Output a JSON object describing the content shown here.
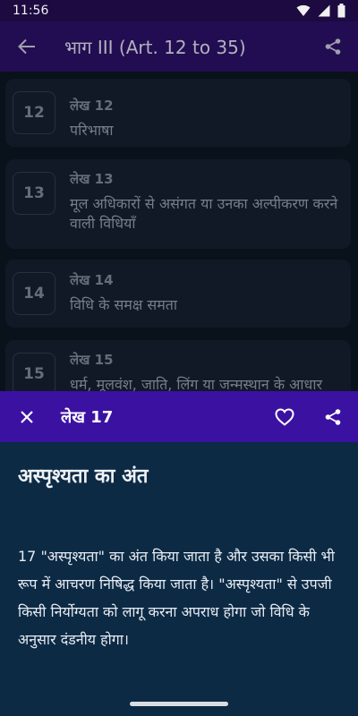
{
  "status": {
    "time": "11:56"
  },
  "app_bar": {
    "title": "भाग III (Art. 12 to 35)"
  },
  "articles": [
    {
      "number": "12",
      "label": "लेख 12",
      "desc": " परिभाषा"
    },
    {
      "number": "13",
      "label": "लेख 13",
      "desc": " मूल अधिकारों से असंगत या उनका अल्पीकरण करने वाली विधियाँ"
    },
    {
      "number": "14",
      "label": "लेख 14",
      "desc": " विधि के समक्ष समता"
    },
    {
      "number": "15",
      "label": "लेख 15",
      "desc": " धर्म, मूलवंश, जाति, लिंग या जन्मस्थान के आधार"
    }
  ],
  "sheet": {
    "title": "लेख 17",
    "heading": "अस्पृश्यता का अंत",
    "body_lines": [
      "17 \"अस्पृश्यता\" का अंत किया जाता है और उसका किसी भी",
      "रूप में आचरण निषिद्ध किया जाता है। \"अस्पृश्यता\" से उपजी",
      "किसी निर्योग्यता को लागू करना अपराध होगा जो विधि के",
      "अनुसार दंडनीय होगा।"
    ]
  },
  "icons": {
    "back": "arrow-left-icon",
    "share": "share-icon",
    "close": "close-icon",
    "favorite": "heart-icon",
    "wifi": "wifi-icon",
    "signal": "signal-icon",
    "battery": "battery-icon"
  },
  "colors": {
    "status_bar": "#1c0a40",
    "app_bar": "#2a1166",
    "sheet_header": "#3b11a2",
    "sheet_body": "#0d2a44",
    "background": "#0c1622"
  }
}
